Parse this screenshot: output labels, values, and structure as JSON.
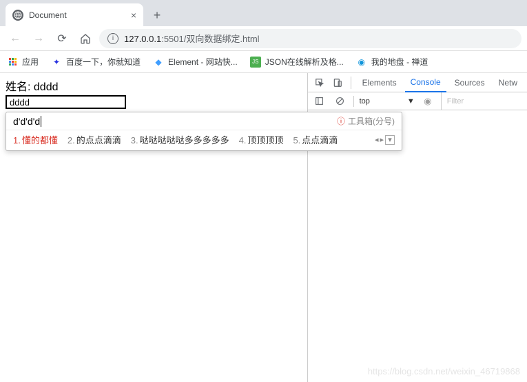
{
  "tab": {
    "title": "Document"
  },
  "address": {
    "host": "127.0.0.1",
    "port": ":5501",
    "path": "/双向数据绑定.html"
  },
  "bookmarks": {
    "apps": "应用",
    "items": [
      {
        "label": "百度一下，你就知道",
        "color": "#2932e1"
      },
      {
        "label": "Element - 网站快...",
        "color": "#409eff"
      },
      {
        "label": "JSON在线解析及格...",
        "color": "#4caf50"
      },
      {
        "label": "我的地盘 - 禅道",
        "color": "#1296db"
      }
    ]
  },
  "page": {
    "label_prefix": "姓名: ",
    "bound_value": "dddd",
    "input_value": "dddd"
  },
  "ime": {
    "composition": "d'd'd'd",
    "toolbox": "工具箱(分号)",
    "candidates": [
      {
        "n": "1.",
        "text": "懂的都懂"
      },
      {
        "n": "2.",
        "text": "的点点滴滴"
      },
      {
        "n": "3.",
        "text": "哒哒哒哒哒多多多多多"
      },
      {
        "n": "4.",
        "text": "顶顶顶顶"
      },
      {
        "n": "5.",
        "text": "点点滴滴"
      }
    ]
  },
  "devtools": {
    "tabs": {
      "elements": "Elements",
      "console": "Console",
      "sources": "Sources",
      "network": "Netw"
    },
    "context": "top",
    "filter_placeholder": "Filter"
  },
  "watermark": "https://blog.csdn.net/weixin_46719868"
}
